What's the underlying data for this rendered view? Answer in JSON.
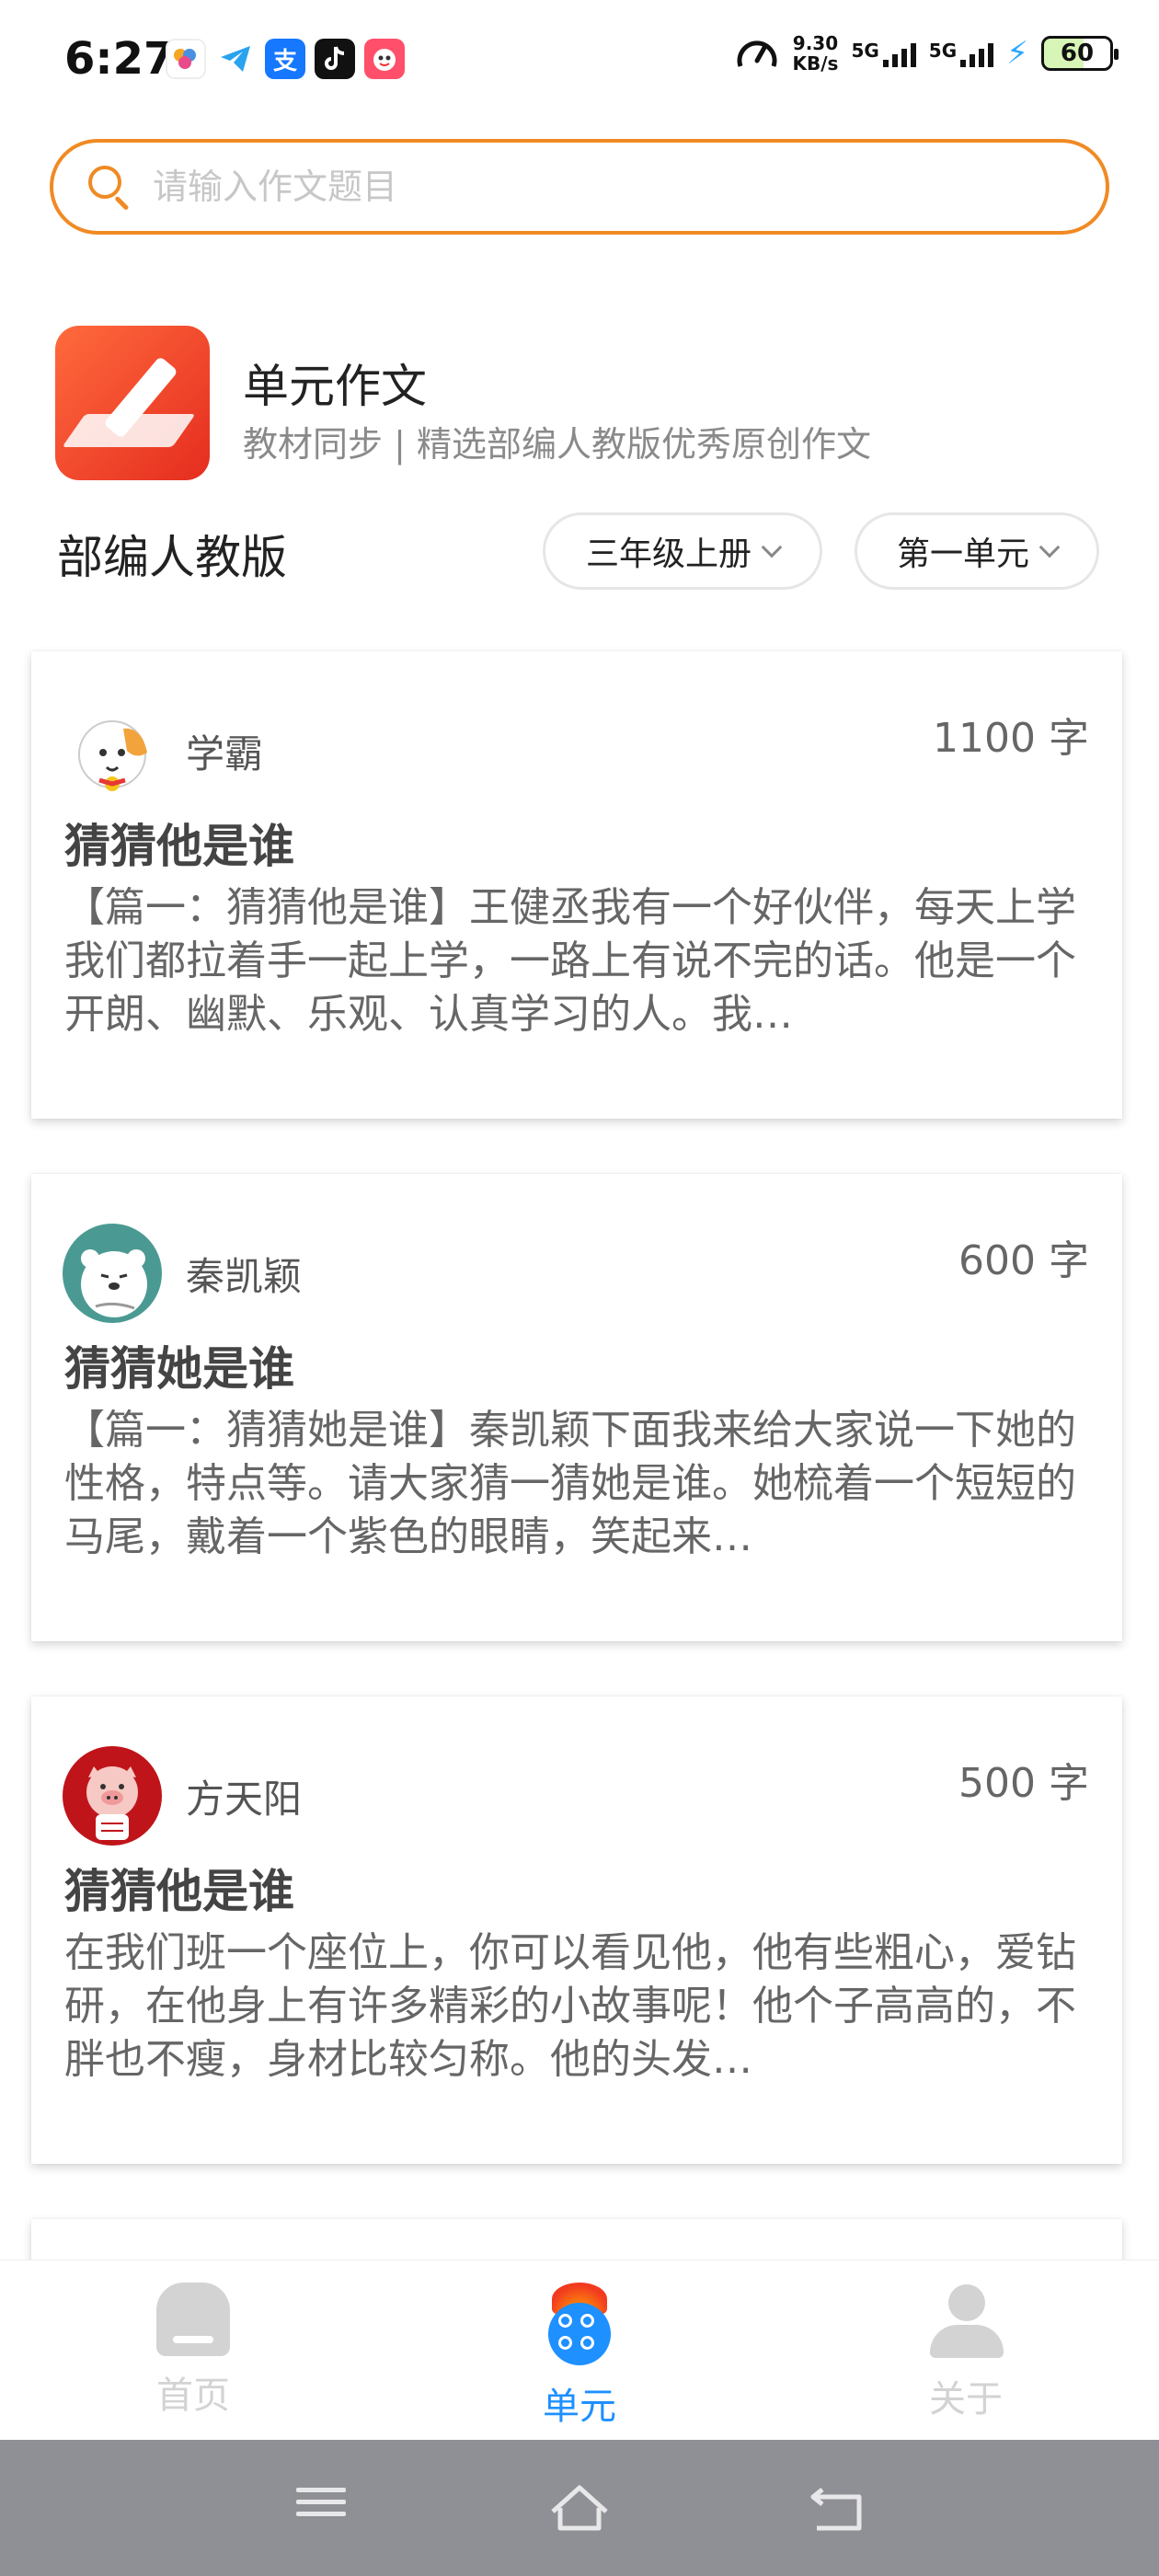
{
  "status_bar": {
    "time": "6:27",
    "net_speed_value": "9.30",
    "net_speed_unit": "KB/s",
    "sim1": "5G",
    "sim2": "5G",
    "battery": "60",
    "app_icons": [
      "cloud-app-icon",
      "telegram-icon",
      "alipay-icon",
      "tiktok-icon",
      "game-app-icon"
    ],
    "alipay_glyph": "支"
  },
  "search": {
    "placeholder": "请输入作文题目"
  },
  "header": {
    "title": "单元作文",
    "subtitle": "教材同步 | 精选部编人教版优秀原创作文"
  },
  "filters": {
    "edition": "部编人教版",
    "grade": "三年级上册",
    "unit": "第一单元"
  },
  "essays": [
    {
      "author": "学霸",
      "word_count": "1100 字",
      "title": "猜猜他是谁",
      "excerpt": "【篇一：猜猜他是谁】王健丞我有一个好伙伴，每天上学我们都拉着手一起上学，一路上有说不完的话。他是一个开朗、幽默、乐观、认真学习的人。我…",
      "avatar": "cat-avatar"
    },
    {
      "author": "秦凯颖",
      "word_count": "600 字",
      "title": "猜猜她是谁",
      "excerpt": "【篇一：猜猜她是谁】秦凯颖下面我来给大家说一下她的性格，特点等。请大家猜一猜她是谁。她梳着一个短短的马尾，戴着一个紫色的眼睛，笑起来…",
      "avatar": "polar-bear-avatar"
    },
    {
      "author": "方天阳",
      "word_count": "500 字",
      "title": "猜猜他是谁",
      "excerpt": "在我们班一个座位上，你可以看见他，他有些粗心，爱钻研，在他身上有许多精彩的小故事呢！他个子高高的，不胖也不瘦，身材比较匀称。他的头发…",
      "avatar": "pig-avatar"
    }
  ],
  "bottom_nav": {
    "items": [
      {
        "label": "首页",
        "icon": "home-icon",
        "active": false
      },
      {
        "label": "单元",
        "icon": "unit-icon",
        "active": true
      },
      {
        "label": "关于",
        "icon": "person-icon",
        "active": false
      }
    ]
  },
  "colors": {
    "accent": "#f08a24",
    "active_tab": "#1e90ff",
    "inactive_tab": "#d3d3d3"
  }
}
